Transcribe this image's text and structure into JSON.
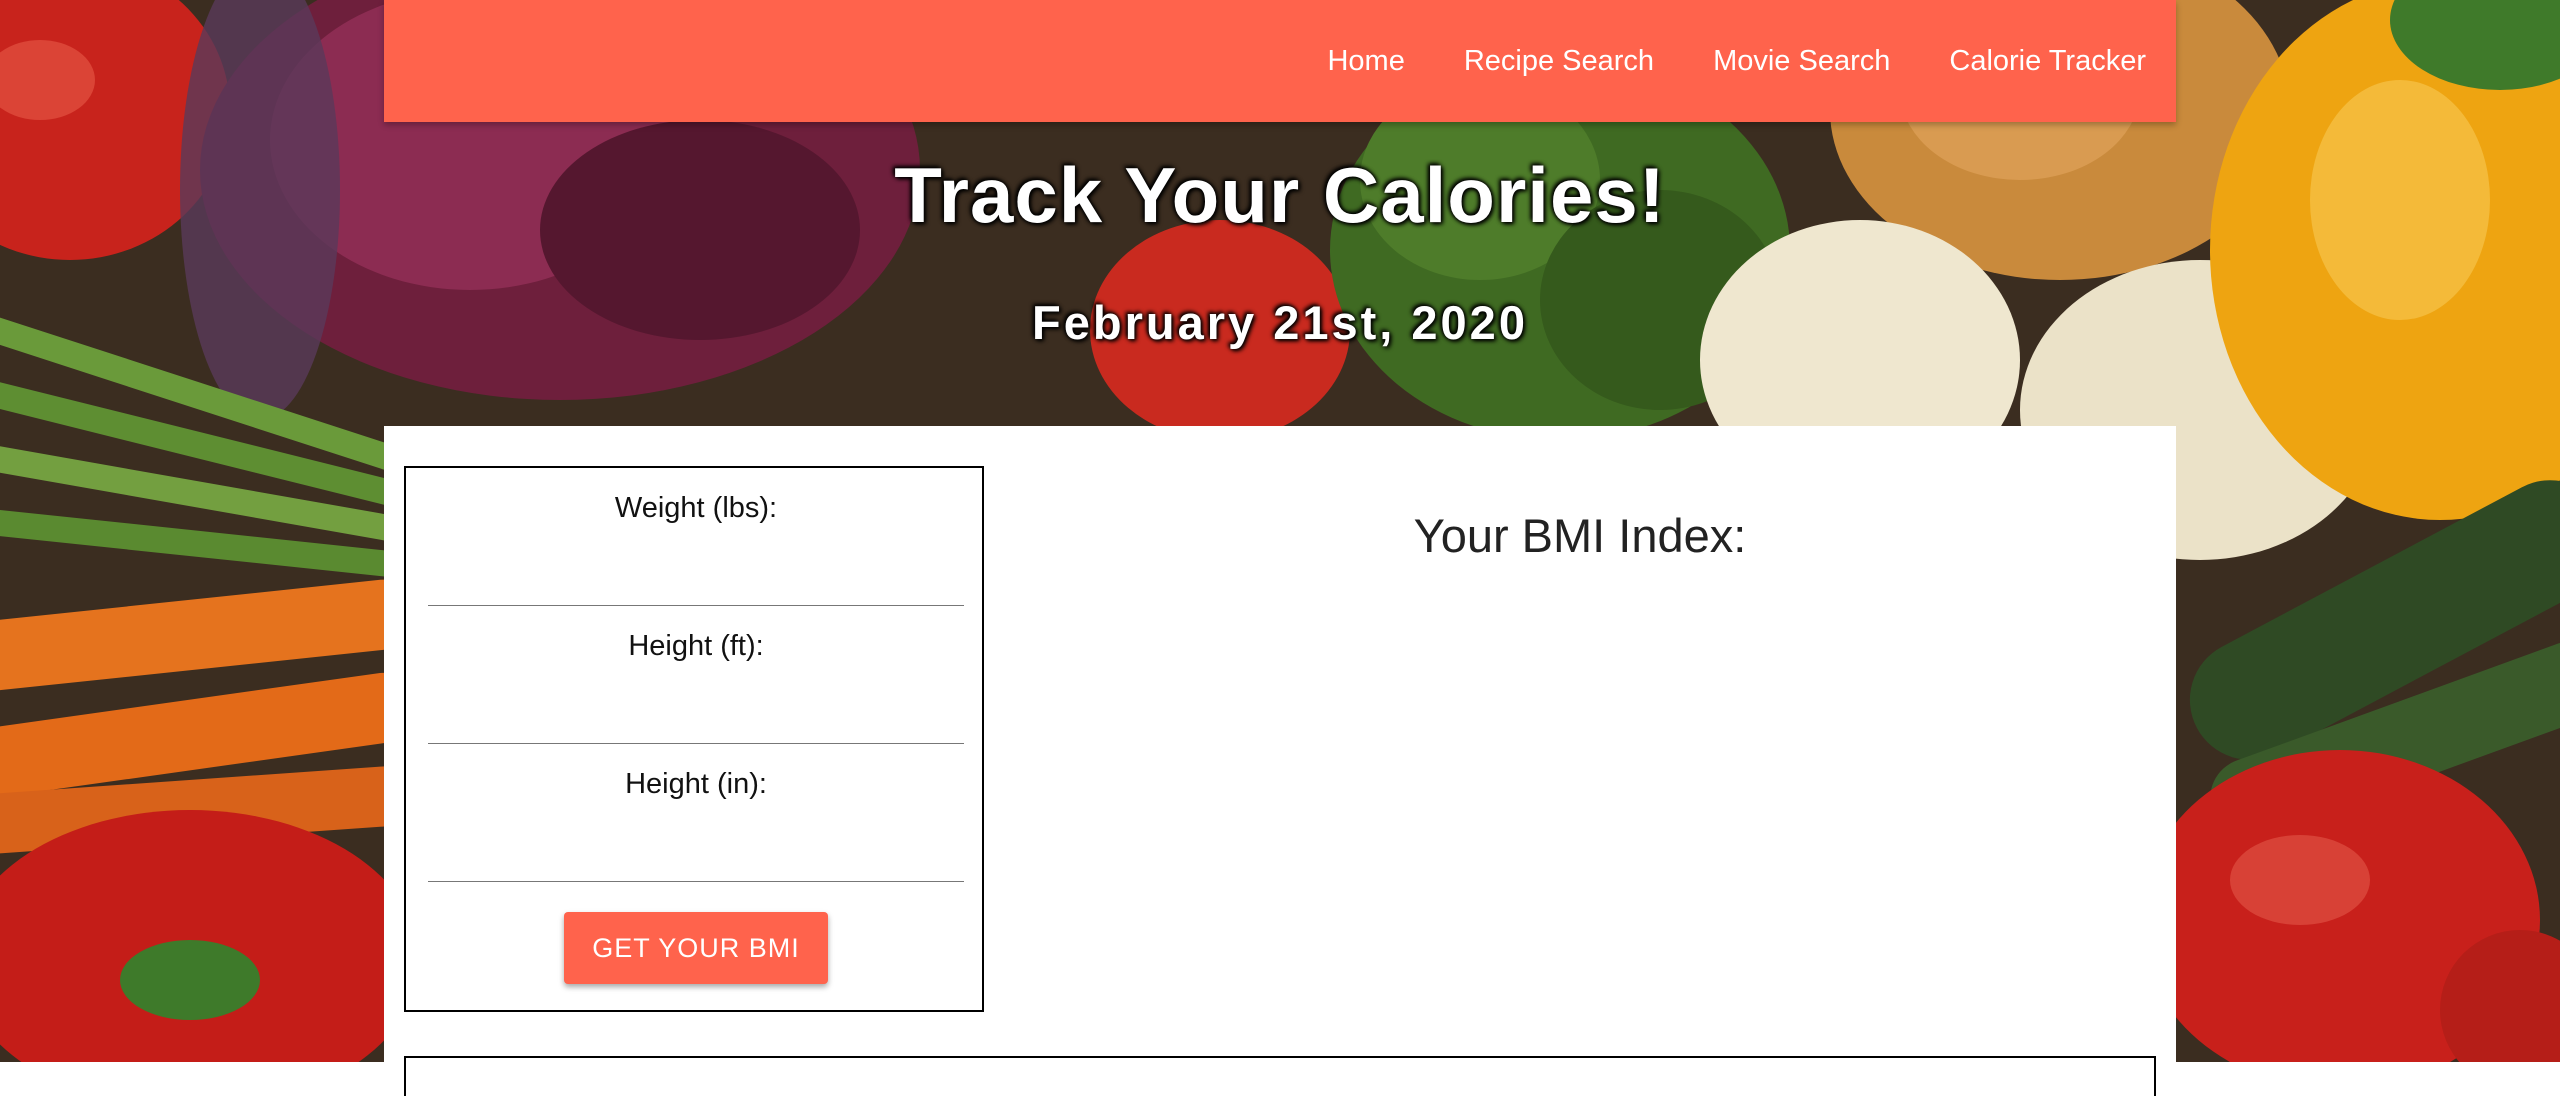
{
  "theme": {
    "accent": "#FF634C"
  },
  "nav": {
    "items": [
      {
        "label": "Home"
      },
      {
        "label": "Recipe Search"
      },
      {
        "label": "Movie Search"
      },
      {
        "label": "Calorie Tracker"
      }
    ]
  },
  "hero": {
    "title": "Track Your Calories!",
    "date": "February 21st, 2020"
  },
  "form": {
    "weight_label": "Weight (lbs):",
    "weight_value": "",
    "height_ft_label": "Height (ft):",
    "height_ft_value": "",
    "height_in_label": "Height (in):",
    "height_in_value": "",
    "submit_label": "GET YOUR BMI"
  },
  "result": {
    "heading": "Your BMI Index:"
  }
}
